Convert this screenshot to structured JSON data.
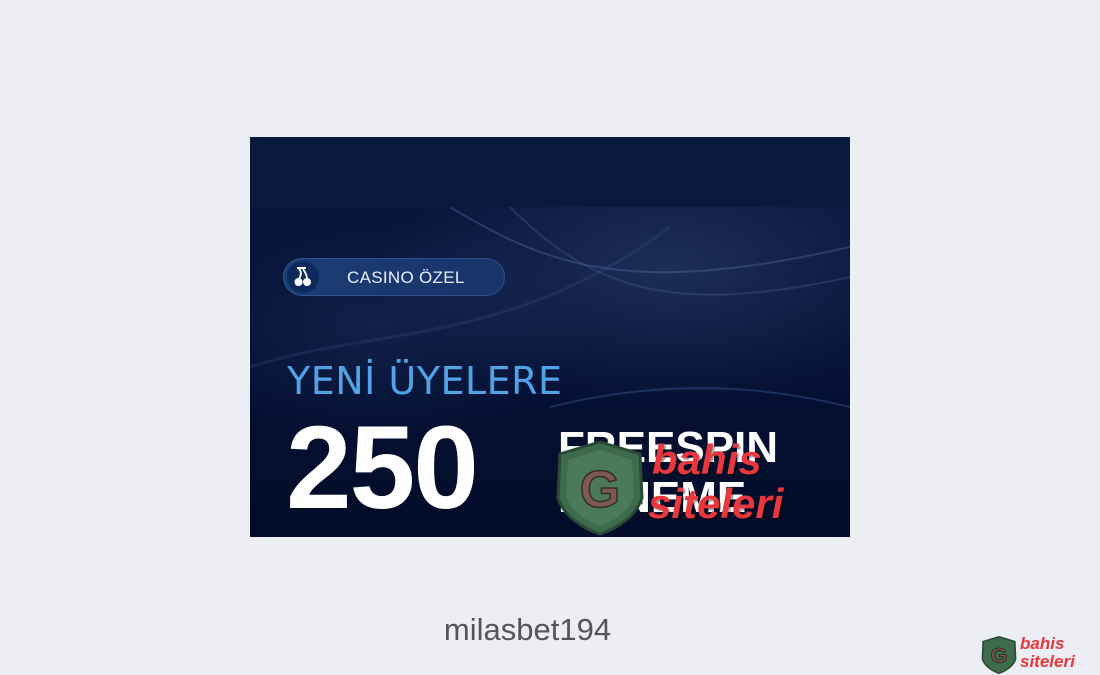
{
  "banner": {
    "badge_label": "CASINO ÖZEL",
    "badge_icon": "cherries-icon",
    "headline": "YENİ ÜYELERE",
    "amount": "250",
    "offer_line1": "FREESPIN",
    "offer_line2": "DENEME"
  },
  "watermark": {
    "line1": "bahis",
    "line2": "siteleri",
    "shield_letter": "G",
    "icon": "shield-g-icon"
  },
  "caption": "milasbet194",
  "corner_logo": {
    "line1": "bahis",
    "line2": "siteleri",
    "shield_letter": "G"
  },
  "colors": {
    "background": "#eceef3",
    "banner_bg": "#06143a",
    "headline": "#4fa3e6",
    "watermark_text": "#e8383d",
    "shield_green": "#3e6b4c"
  }
}
